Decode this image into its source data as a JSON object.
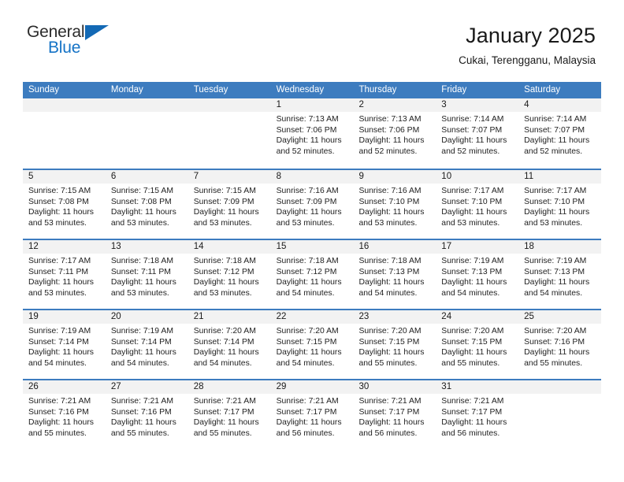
{
  "brand": {
    "name_top": "General",
    "name_bottom": "Blue",
    "accent_color": "#1573c6",
    "triangle_color": "#1369b5"
  },
  "header": {
    "month_title": "January 2025",
    "location": "Cukai, Terengganu, Malaysia"
  },
  "calendar": {
    "header_bg": "#3d7cbf",
    "daynum_bg": "#f2f2f2",
    "weekdays": [
      "Sunday",
      "Monday",
      "Tuesday",
      "Wednesday",
      "Thursday",
      "Friday",
      "Saturday"
    ],
    "weeks": [
      [
        {
          "day": "",
          "empty": true
        },
        {
          "day": "",
          "empty": true
        },
        {
          "day": "",
          "empty": true
        },
        {
          "day": "1",
          "sunrise": "Sunrise: 7:13 AM",
          "sunset": "Sunset: 7:06 PM",
          "daylight_1": "Daylight: 11 hours",
          "daylight_2": "and 52 minutes."
        },
        {
          "day": "2",
          "sunrise": "Sunrise: 7:13 AM",
          "sunset": "Sunset: 7:06 PM",
          "daylight_1": "Daylight: 11 hours",
          "daylight_2": "and 52 minutes."
        },
        {
          "day": "3",
          "sunrise": "Sunrise: 7:14 AM",
          "sunset": "Sunset: 7:07 PM",
          "daylight_1": "Daylight: 11 hours",
          "daylight_2": "and 52 minutes."
        },
        {
          "day": "4",
          "sunrise": "Sunrise: 7:14 AM",
          "sunset": "Sunset: 7:07 PM",
          "daylight_1": "Daylight: 11 hours",
          "daylight_2": "and 52 minutes."
        }
      ],
      [
        {
          "day": "5",
          "sunrise": "Sunrise: 7:15 AM",
          "sunset": "Sunset: 7:08 PM",
          "daylight_1": "Daylight: 11 hours",
          "daylight_2": "and 53 minutes."
        },
        {
          "day": "6",
          "sunrise": "Sunrise: 7:15 AM",
          "sunset": "Sunset: 7:08 PM",
          "daylight_1": "Daylight: 11 hours",
          "daylight_2": "and 53 minutes."
        },
        {
          "day": "7",
          "sunrise": "Sunrise: 7:15 AM",
          "sunset": "Sunset: 7:09 PM",
          "daylight_1": "Daylight: 11 hours",
          "daylight_2": "and 53 minutes."
        },
        {
          "day": "8",
          "sunrise": "Sunrise: 7:16 AM",
          "sunset": "Sunset: 7:09 PM",
          "daylight_1": "Daylight: 11 hours",
          "daylight_2": "and 53 minutes."
        },
        {
          "day": "9",
          "sunrise": "Sunrise: 7:16 AM",
          "sunset": "Sunset: 7:10 PM",
          "daylight_1": "Daylight: 11 hours",
          "daylight_2": "and 53 minutes."
        },
        {
          "day": "10",
          "sunrise": "Sunrise: 7:17 AM",
          "sunset": "Sunset: 7:10 PM",
          "daylight_1": "Daylight: 11 hours",
          "daylight_2": "and 53 minutes."
        },
        {
          "day": "11",
          "sunrise": "Sunrise: 7:17 AM",
          "sunset": "Sunset: 7:10 PM",
          "daylight_1": "Daylight: 11 hours",
          "daylight_2": "and 53 minutes."
        }
      ],
      [
        {
          "day": "12",
          "sunrise": "Sunrise: 7:17 AM",
          "sunset": "Sunset: 7:11 PM",
          "daylight_1": "Daylight: 11 hours",
          "daylight_2": "and 53 minutes."
        },
        {
          "day": "13",
          "sunrise": "Sunrise: 7:18 AM",
          "sunset": "Sunset: 7:11 PM",
          "daylight_1": "Daylight: 11 hours",
          "daylight_2": "and 53 minutes."
        },
        {
          "day": "14",
          "sunrise": "Sunrise: 7:18 AM",
          "sunset": "Sunset: 7:12 PM",
          "daylight_1": "Daylight: 11 hours",
          "daylight_2": "and 53 minutes."
        },
        {
          "day": "15",
          "sunrise": "Sunrise: 7:18 AM",
          "sunset": "Sunset: 7:12 PM",
          "daylight_1": "Daylight: 11 hours",
          "daylight_2": "and 54 minutes."
        },
        {
          "day": "16",
          "sunrise": "Sunrise: 7:18 AM",
          "sunset": "Sunset: 7:13 PM",
          "daylight_1": "Daylight: 11 hours",
          "daylight_2": "and 54 minutes."
        },
        {
          "day": "17",
          "sunrise": "Sunrise: 7:19 AM",
          "sunset": "Sunset: 7:13 PM",
          "daylight_1": "Daylight: 11 hours",
          "daylight_2": "and 54 minutes."
        },
        {
          "day": "18",
          "sunrise": "Sunrise: 7:19 AM",
          "sunset": "Sunset: 7:13 PM",
          "daylight_1": "Daylight: 11 hours",
          "daylight_2": "and 54 minutes."
        }
      ],
      [
        {
          "day": "19",
          "sunrise": "Sunrise: 7:19 AM",
          "sunset": "Sunset: 7:14 PM",
          "daylight_1": "Daylight: 11 hours",
          "daylight_2": "and 54 minutes."
        },
        {
          "day": "20",
          "sunrise": "Sunrise: 7:19 AM",
          "sunset": "Sunset: 7:14 PM",
          "daylight_1": "Daylight: 11 hours",
          "daylight_2": "and 54 minutes."
        },
        {
          "day": "21",
          "sunrise": "Sunrise: 7:20 AM",
          "sunset": "Sunset: 7:14 PM",
          "daylight_1": "Daylight: 11 hours",
          "daylight_2": "and 54 minutes."
        },
        {
          "day": "22",
          "sunrise": "Sunrise: 7:20 AM",
          "sunset": "Sunset: 7:15 PM",
          "daylight_1": "Daylight: 11 hours",
          "daylight_2": "and 54 minutes."
        },
        {
          "day": "23",
          "sunrise": "Sunrise: 7:20 AM",
          "sunset": "Sunset: 7:15 PM",
          "daylight_1": "Daylight: 11 hours",
          "daylight_2": "and 55 minutes."
        },
        {
          "day": "24",
          "sunrise": "Sunrise: 7:20 AM",
          "sunset": "Sunset: 7:15 PM",
          "daylight_1": "Daylight: 11 hours",
          "daylight_2": "and 55 minutes."
        },
        {
          "day": "25",
          "sunrise": "Sunrise: 7:20 AM",
          "sunset": "Sunset: 7:16 PM",
          "daylight_1": "Daylight: 11 hours",
          "daylight_2": "and 55 minutes."
        }
      ],
      [
        {
          "day": "26",
          "sunrise": "Sunrise: 7:21 AM",
          "sunset": "Sunset: 7:16 PM",
          "daylight_1": "Daylight: 11 hours",
          "daylight_2": "and 55 minutes."
        },
        {
          "day": "27",
          "sunrise": "Sunrise: 7:21 AM",
          "sunset": "Sunset: 7:16 PM",
          "daylight_1": "Daylight: 11 hours",
          "daylight_2": "and 55 minutes."
        },
        {
          "day": "28",
          "sunrise": "Sunrise: 7:21 AM",
          "sunset": "Sunset: 7:17 PM",
          "daylight_1": "Daylight: 11 hours",
          "daylight_2": "and 55 minutes."
        },
        {
          "day": "29",
          "sunrise": "Sunrise: 7:21 AM",
          "sunset": "Sunset: 7:17 PM",
          "daylight_1": "Daylight: 11 hours",
          "daylight_2": "and 56 minutes."
        },
        {
          "day": "30",
          "sunrise": "Sunrise: 7:21 AM",
          "sunset": "Sunset: 7:17 PM",
          "daylight_1": "Daylight: 11 hours",
          "daylight_2": "and 56 minutes."
        },
        {
          "day": "31",
          "sunrise": "Sunrise: 7:21 AM",
          "sunset": "Sunset: 7:17 PM",
          "daylight_1": "Daylight: 11 hours",
          "daylight_2": "and 56 minutes."
        },
        {
          "day": "",
          "empty": true
        }
      ]
    ]
  }
}
